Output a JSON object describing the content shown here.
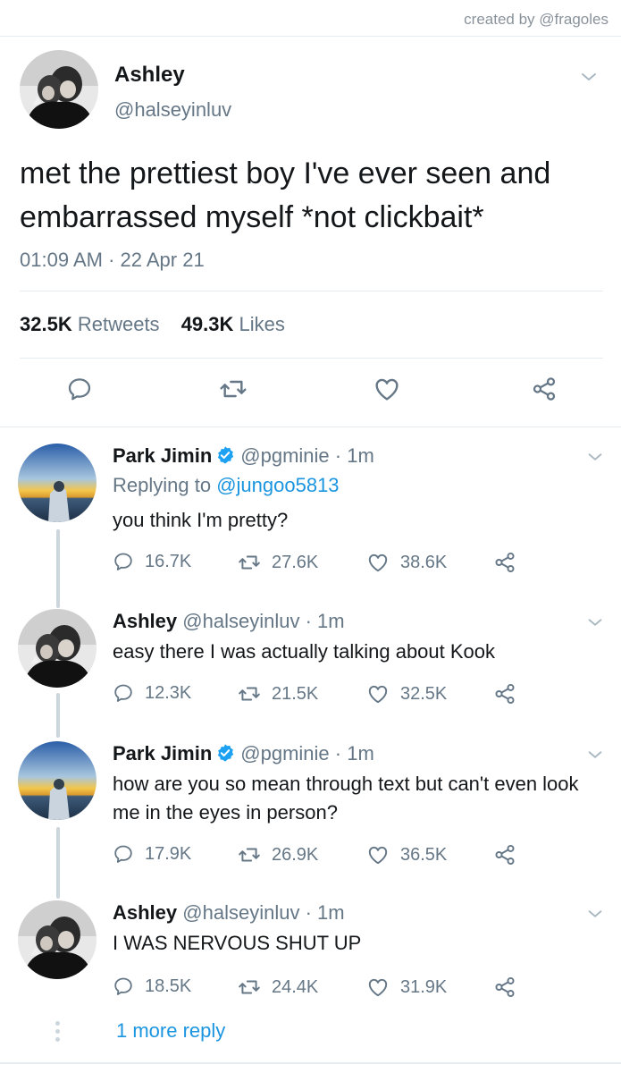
{
  "credit": "created by @fragoles",
  "main": {
    "name": "Ashley",
    "handle": "@halseyinluv",
    "text": "met the prettiest boy I've ever seen and embarrassed myself *not clickbait*",
    "timestamp": "01:09 AM · 22 Apr 21",
    "retweets_count": "32.5K",
    "retweets_label": "Retweets",
    "likes_count": "49.3K",
    "likes_label": "Likes"
  },
  "colors": {
    "link": "#1b95e0",
    "muted": "#657786",
    "verified": "#1da1f2",
    "divider": "#e6ecf0"
  },
  "icons": [
    "reply-icon",
    "retweet-icon",
    "like-icon",
    "share-icon",
    "chevron-down-icon",
    "verified-badge-icon"
  ],
  "replies": [
    {
      "name": "Park Jimin",
      "verified": true,
      "handle": "@pgminie",
      "dot": "·",
      "time": "1m",
      "replying_prefix": "Replying to",
      "replying_to": "@jungoo5813",
      "text": "you think I'm pretty?",
      "replies": "16.7K",
      "retweets": "27.6K",
      "likes": "38.6K"
    },
    {
      "name": "Ashley",
      "verified": false,
      "handle": "@halseyinluv",
      "dot": "·",
      "time": "1m",
      "text": "easy there I was actually talking about Kook",
      "replies": "12.3K",
      "retweets": "21.5K",
      "likes": "32.5K"
    },
    {
      "name": "Park Jimin",
      "verified": true,
      "handle": "@pgminie",
      "dot": "·",
      "time": "1m",
      "text": "how are you so mean through text but can't even look me in the eyes in person?",
      "replies": "17.9K",
      "retweets": "26.9K",
      "likes": "36.5K"
    },
    {
      "name": "Ashley",
      "verified": false,
      "handle": "@halseyinluv",
      "dot": "·",
      "time": "1m",
      "text": "I WAS NERVOUS SHUT UP",
      "replies": "18.5K",
      "retweets": "24.4K",
      "likes": "31.9K"
    }
  ],
  "more_replies": "1 more reply"
}
